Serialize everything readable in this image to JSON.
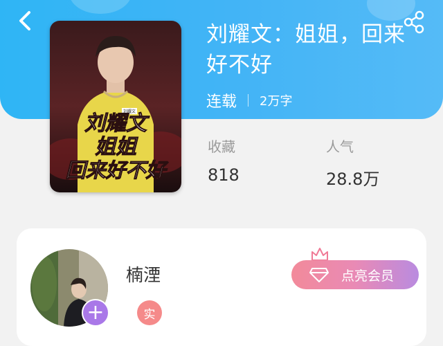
{
  "header": {
    "back_icon": "chevron-left-icon",
    "share_icon": "share-icon"
  },
  "book": {
    "title": "刘耀文：姐姐，回来好不好",
    "status": "连载",
    "word_count": "2万字",
    "cover": {
      "name_tag": "刘耀文",
      "title_lines": [
        "刘耀文",
        "姐姐",
        "回来好不好"
      ]
    },
    "stats": {
      "collect_label": "收藏",
      "collect_value": "818",
      "popularity_label": "人气",
      "popularity_value": "28.8万"
    }
  },
  "author": {
    "name": "楠湮",
    "verified_badge": "实",
    "follow_icon": "plus-icon",
    "vip_button_label": "点亮会员"
  },
  "colors": {
    "header_blue": "#3ab3f5",
    "vip_gradient_start": "#f28a9a",
    "vip_gradient_end": "#b98be0",
    "follow_purple": "#a978e8",
    "badge_red": "#f58a8a"
  }
}
